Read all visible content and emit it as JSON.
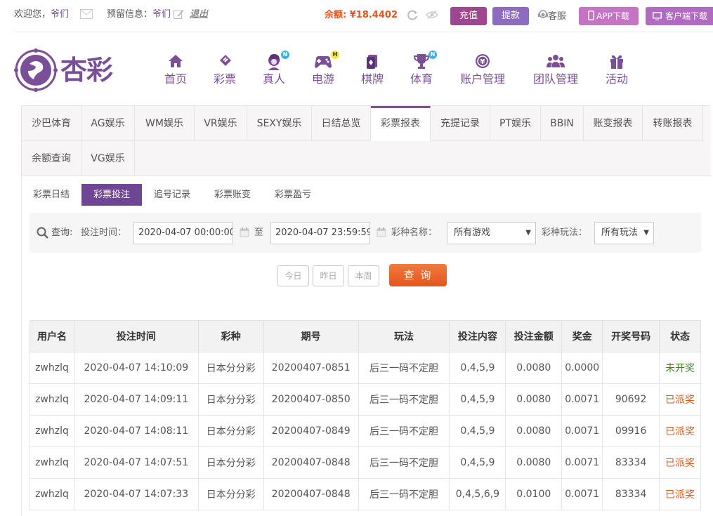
{
  "topbar": {
    "welcome": "欢迎您，",
    "username": "爷们",
    "reserved_label": "预留信息：",
    "reserved_value": "爷们",
    "logout": "退出",
    "balance_label": "余额:",
    "balance_value": "¥18.4402",
    "deposit": "充值",
    "withdraw": "提款",
    "service": "客服",
    "app_download": "APP下载",
    "client_download": "客户端下载"
  },
  "colors": {
    "brand": "#7b4f98",
    "deposit": "#a0458f",
    "withdraw": "#8d6bc0",
    "app": "#c773c4",
    "client": "#b06bc0",
    "orange": "#e4551f"
  },
  "logo": {
    "text": "杏彩"
  },
  "nav": {
    "items": [
      {
        "label": "首页",
        "icon": "home-icon"
      },
      {
        "label": "彩票",
        "icon": "ticket-icon"
      },
      {
        "label": "真人",
        "icon": "live-dealer-icon",
        "badge": "N"
      },
      {
        "label": "电游",
        "icon": "gamepad-icon",
        "badge": "H"
      },
      {
        "label": "棋牌",
        "icon": "cards-icon"
      },
      {
        "label": "体育",
        "icon": "trophy-icon",
        "badge": "N"
      },
      {
        "label": "账户管理",
        "icon": "account-icon"
      },
      {
        "label": "团队管理",
        "icon": "team-icon"
      },
      {
        "label": "活动",
        "icon": "gift-icon"
      }
    ]
  },
  "tabs": [
    "沙巴体育",
    "AG娱乐",
    "WM娱乐",
    "VR娱乐",
    "SEXY娱乐",
    "日结总览",
    "彩票报表",
    "充提记录",
    "PT娱乐",
    "BBIN",
    "账变报表",
    "转账报表",
    "余额查询",
    "VG娱乐"
  ],
  "subtabs": [
    "彩票日结",
    "彩票投注",
    "追号记录",
    "彩票账变",
    "彩票盈亏"
  ],
  "query": {
    "label": "查询:",
    "time_label": "投注时间：",
    "start": "2020-04-07 00:00:00",
    "to": "至",
    "end": "2020-04-07 23:59:59",
    "game_label": "彩种名称：",
    "game_value": "所有游戏",
    "play_label": "彩种玩法：",
    "play_value": "所有玩法",
    "today": "今日",
    "yesterday": "昨日",
    "this_week": "本周",
    "search": "查 询"
  },
  "table": {
    "headers": [
      "用户名",
      "投注时间",
      "彩种",
      "期号",
      "玩法",
      "投注内容",
      "投注金额",
      "奖金",
      "开奖号码",
      "状态"
    ],
    "rows": [
      [
        "zwhzlq",
        "2020-04-07 14:10:09",
        "日本分分彩",
        "20200407-0851",
        "后三一码不定胆",
        "0,4,5,9",
        "0.0080",
        "0.0000",
        "",
        "未开奖"
      ],
      [
        "zwhzlq",
        "2020-04-07 14:09:11",
        "日本分分彩",
        "20200407-0850",
        "后三一码不定胆",
        "0,4,5,9",
        "0.0080",
        "0.0071",
        "90692",
        "已派奖"
      ],
      [
        "zwhzlq",
        "2020-04-07 14:08:11",
        "日本分分彩",
        "20200407-0849",
        "后三一码不定胆",
        "0,4,5,9",
        "0.0080",
        "0.0071",
        "09916",
        "已派奖"
      ],
      [
        "zwhzlq",
        "2020-04-07 14:07:51",
        "日本分分彩",
        "20200407-0848",
        "后三一码不定胆",
        "0,4,5,9",
        "0.0080",
        "0.0071",
        "83334",
        "已派奖"
      ],
      [
        "zwhzlq",
        "2020-04-07 14:07:33",
        "日本分分彩",
        "20200407-0848",
        "后三一码不定胆",
        "0,4,5,6,9",
        "0.0100",
        "0.0071",
        "83334",
        "已派奖"
      ]
    ]
  }
}
